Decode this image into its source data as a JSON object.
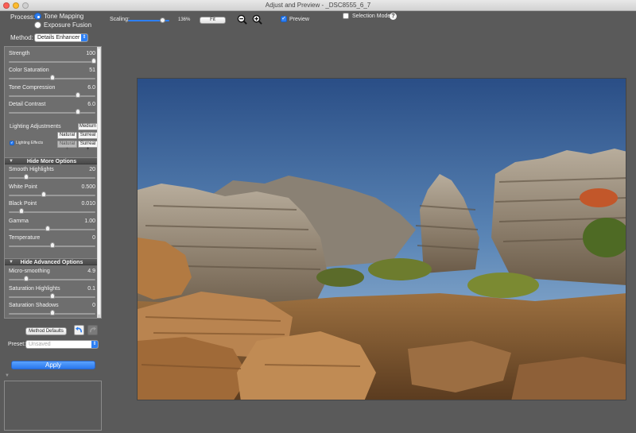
{
  "window": {
    "title": "Adjust and Preview - _DSC8555_6_7"
  },
  "process": {
    "label": "Process:",
    "options": [
      {
        "label": "Tone Mapping",
        "selected": true
      },
      {
        "label": "Exposure Fusion",
        "selected": false
      }
    ]
  },
  "method": {
    "label": "Method:",
    "value": "Details Enhancer"
  },
  "toolbar": {
    "scaling_label": "Scaling:",
    "scaling_value": "136%",
    "scaling_fraction": 0.85,
    "fit_label": "Fit",
    "preview_label": "Preview",
    "preview_checked": true,
    "selection_mode_label": "Selection Mode",
    "selection_mode_checked": false,
    "help_label": "?"
  },
  "params": [
    {
      "name": "Strength",
      "value": "100",
      "fraction": 0.98
    },
    {
      "name": "Color Saturation",
      "value": "51",
      "fraction": 0.5
    },
    {
      "name": "Tone Compression",
      "value": "6.0",
      "fraction": 0.8
    },
    {
      "name": "Detail Contrast",
      "value": "6.0",
      "fraction": 0.8
    }
  ],
  "lighting": {
    "label": "Lighting Adjustments",
    "effects_label": "Lighting Effects",
    "effects_checked": true,
    "buttons": {
      "medium": "Medium",
      "natural": "Natural",
      "surreal": "Surreal",
      "natural_plus": "Natural +",
      "surreal_plus": "Surreal +"
    }
  },
  "more_options": {
    "title": "Hide More Options",
    "params": [
      {
        "name": "Smooth Highlights",
        "value": "20",
        "fraction": 0.2
      },
      {
        "name": "White Point",
        "value": "0.500",
        "fraction": 0.4
      },
      {
        "name": "Black Point",
        "value": "0.010",
        "fraction": 0.15
      },
      {
        "name": "Gamma",
        "value": "1.00",
        "fraction": 0.45
      },
      {
        "name": "Temperature",
        "value": "0",
        "fraction": 0.5
      }
    ]
  },
  "advanced_options": {
    "title": "Hide Advanced Options",
    "params": [
      {
        "name": "Micro-smoothing",
        "value": "4.9",
        "fraction": 0.2
      },
      {
        "name": "Saturation Highlights",
        "value": "0.1",
        "fraction": 0.5
      },
      {
        "name": "Saturation Shadows",
        "value": "0",
        "fraction": 0.5
      }
    ]
  },
  "bottom": {
    "method_defaults_label": "Method Defaults",
    "preset_label": "Preset:",
    "preset_value": "Unsaved",
    "apply_label": "Apply"
  },
  "colors": {
    "accent": "#2d7ff3",
    "background": "#5a5a5a",
    "panel": "#6e6e6e"
  }
}
